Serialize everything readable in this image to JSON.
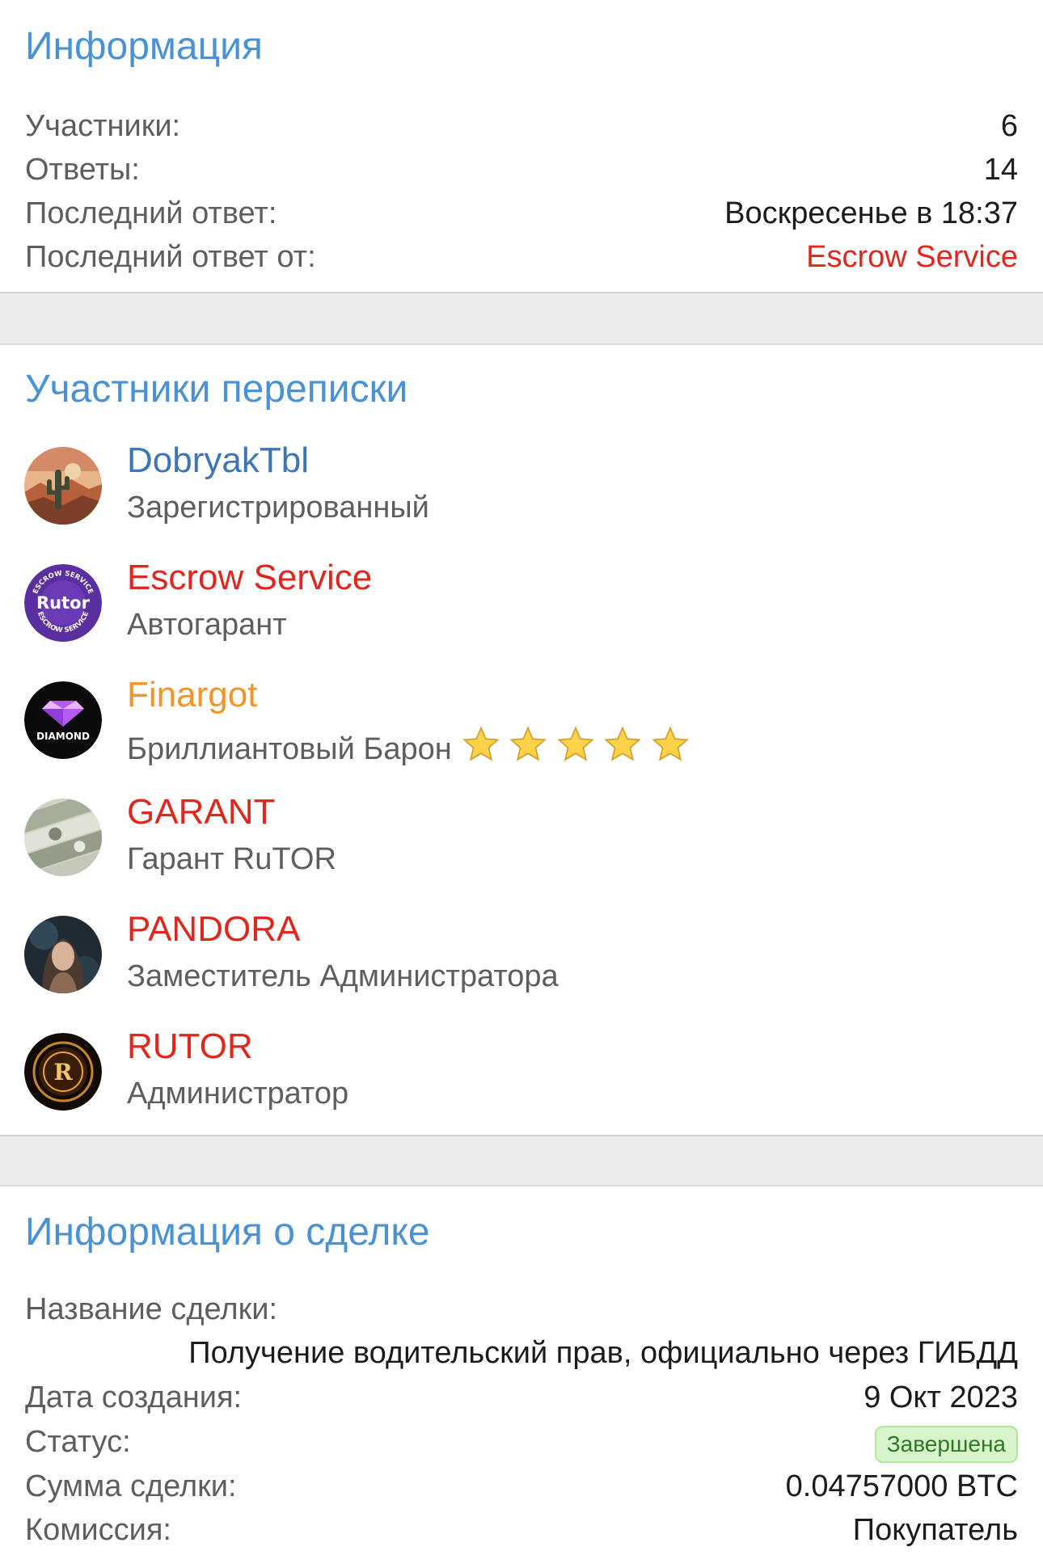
{
  "info": {
    "title": "Информация",
    "rows": [
      {
        "label": "Участники:",
        "value": "6"
      },
      {
        "label": "Ответы:",
        "value": "14"
      },
      {
        "label": "Последний ответ:",
        "value": "Воскресенье в 18:37"
      },
      {
        "label": "Последний ответ от:",
        "value": "Escrow Service"
      }
    ]
  },
  "participants": {
    "title": "Участники переписки",
    "members": [
      {
        "name": "DobryakTbl",
        "role": "Зарегистрированный",
        "avatar_icon": "desert-cactus-avatar"
      },
      {
        "name": "Escrow Service",
        "role": "Автогарант",
        "avatar_icon": "escrow-rutor-badge-avatar",
        "avatar_text": "Rutor",
        "avatar_ring_text": "ESCROW SERVICE"
      },
      {
        "name": "Finargot",
        "role": "Бриллиантовый Барон",
        "stars": 5,
        "avatar_icon": "diamond-avatar",
        "avatar_text": "DIAMOND"
      },
      {
        "name": "GARANT",
        "role": "Гарант RuTOR",
        "avatar_icon": "money-avatar"
      },
      {
        "name": "PANDORA",
        "role": "Заместитель Администратора",
        "avatar_icon": "woman-portrait-avatar"
      },
      {
        "name": "RUTOR",
        "role": "Администратор",
        "avatar_icon": "gold-r-emblem-avatar",
        "avatar_text": "R"
      }
    ]
  },
  "deal": {
    "title": "Информация о сделке",
    "name_label": "Название сделки:",
    "name_value": "Получение водительский прав, официально через ГИБДД",
    "date_label": "Дата создания:",
    "date_value": "9 Окт 2023",
    "status_label": "Статус:",
    "status_value": "Завершена",
    "amount_label": "Сумма сделки:",
    "amount_value": "0.04757000 BTC",
    "fee_label": "Комиссия:",
    "fee_value": "Покупатель"
  },
  "colors": {
    "title_blue": "#4a92d4",
    "link_blue": "#3d76b6",
    "red": "#e0271d",
    "orange": "#f0952a",
    "status_green_bg": "#d8f4cc"
  }
}
